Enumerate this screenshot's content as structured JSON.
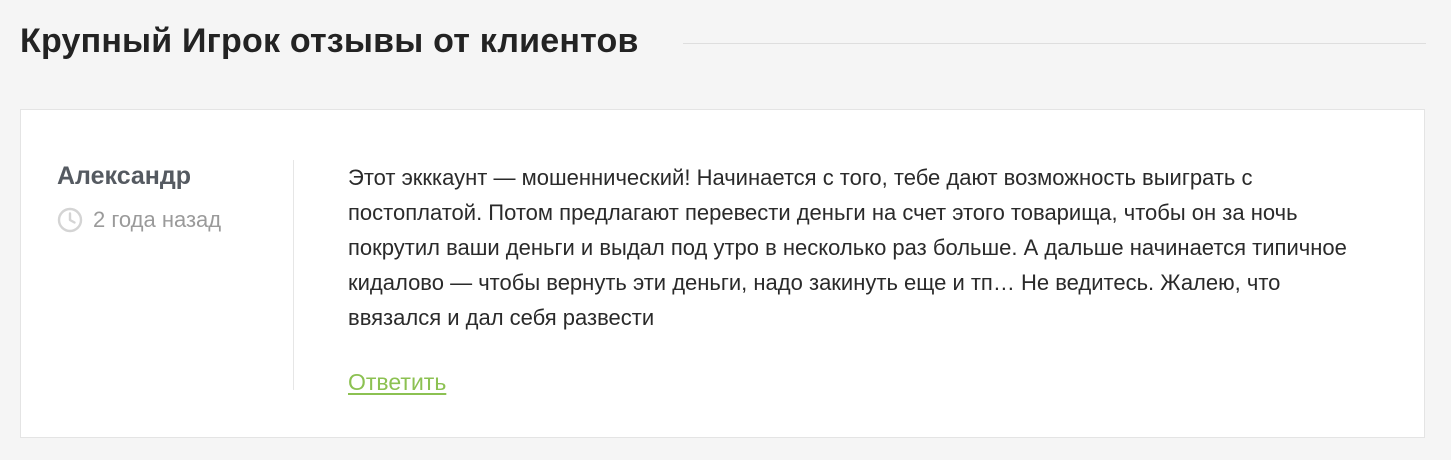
{
  "section": {
    "title": "Крупный Игрок отзывы от клиентов"
  },
  "review": {
    "author": "Александр",
    "date": "2 года назад",
    "date_icon": "clock-icon",
    "text": "Этот экккаунт — мошеннический! Начинается с того, тебе дают возможность выиграть с постоплатой. Потом предлагают перевести деньги на счет этого товарища, чтобы он за ночь покрутил ваши деньги и выдал под утро в несколько раз больше. А дальше начинается типичное кидалово — чтобы вернуть эти деньги, надо закинуть еще и тп… Не ведитесь. Жалею, что ввязался и дал себя развести",
    "reply_label": "Ответить"
  },
  "colors": {
    "background": "#f5f5f5",
    "card": "#ffffff",
    "author": "#555a61",
    "muted": "#9a9a9a",
    "link": "#8cc152"
  }
}
